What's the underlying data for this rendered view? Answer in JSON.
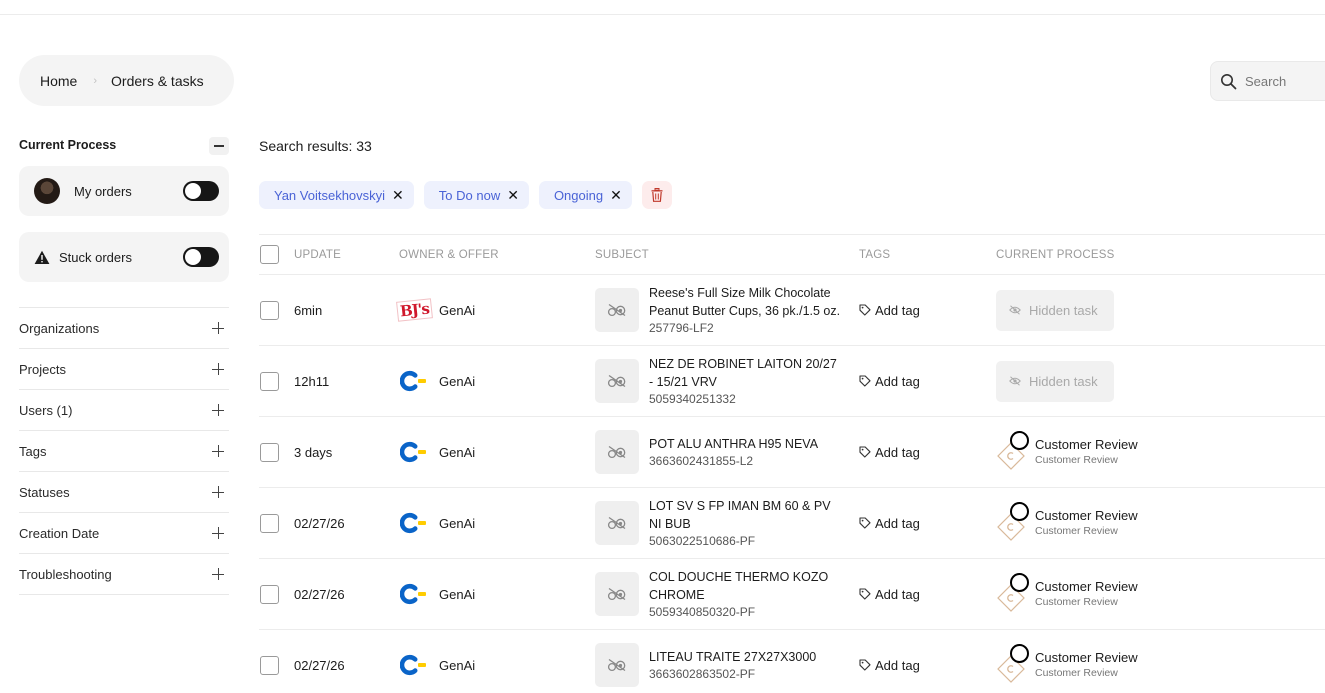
{
  "breadcrumb": {
    "home": "Home",
    "current": "Orders & tasks"
  },
  "search": {
    "placeholder": "Search"
  },
  "sidebar": {
    "current_process_title": "Current Process",
    "my_orders_label": "My orders",
    "stuck_orders_label": "Stuck orders",
    "filters": [
      "Organizations",
      "Projects",
      "Users (1)",
      "Tags",
      "Statuses",
      "Creation Date",
      "Troubleshooting"
    ]
  },
  "main": {
    "results_label": "Search results: 33",
    "chips": [
      "Yan Voitsekhovskyi",
      "To Do now",
      "Ongoing"
    ],
    "columns": {
      "update": "UPDATE",
      "owner_offer": "OWNER & OFFER",
      "subject": "SUBJECT",
      "tags": "TAGS",
      "current_process": "CURRENT PROCESS"
    },
    "add_tag_label": "Add tag",
    "rows": [
      {
        "update": "6min",
        "logo": "bjs-logo",
        "owner": "GenAi",
        "title": "Reese's Full Size Milk Chocolate Peanut Butter Cups, 36 pk./1.5 oz.",
        "sku": "257796-LF2",
        "process_type": "hidden",
        "process_label": "Hidden task",
        "process_sub": ""
      },
      {
        "update": "12h11",
        "logo": "c-logo",
        "owner": "GenAi",
        "title": "NEZ DE ROBINET LAITON 20/27 - 15/21 VRV",
        "sku": "5059340251332",
        "process_type": "hidden",
        "process_label": "Hidden task",
        "process_sub": ""
      },
      {
        "update": "3 days",
        "logo": "c-logo",
        "owner": "GenAi",
        "title": "POT ALU ANTHRA H95 NEVA",
        "sku": "3663602431855-L2",
        "process_type": "review",
        "process_label": "Customer Review",
        "process_sub": "Customer Review"
      },
      {
        "update": "02/27/26",
        "logo": "c-logo",
        "owner": "GenAi",
        "title": "LOT SV S FP IMAN BM 60 & PV NI BUB",
        "sku": "5063022510686-PF",
        "process_type": "review",
        "process_label": "Customer Review",
        "process_sub": "Customer Review"
      },
      {
        "update": "02/27/26",
        "logo": "c-logo",
        "owner": "GenAi",
        "title": "COL DOUCHE THERMO KOZO CHROME",
        "sku": "5059340850320-PF",
        "process_type": "review",
        "process_label": "Customer Review",
        "process_sub": "Customer Review"
      },
      {
        "update": "02/27/26",
        "logo": "c-logo",
        "owner": "GenAi",
        "title": "LITEAU TRAITE 27X27X3000",
        "sku": "3663602863502-PF",
        "process_type": "review",
        "process_label": "Customer Review",
        "process_sub": "Customer Review"
      }
    ]
  },
  "colors": {
    "chip_bg": "#eef1fd",
    "chip_text": "#4a63d6",
    "logo_blue": "#0a64c8",
    "logo_yellow": "#ffcc00",
    "bjs_red": "#d0182c"
  }
}
